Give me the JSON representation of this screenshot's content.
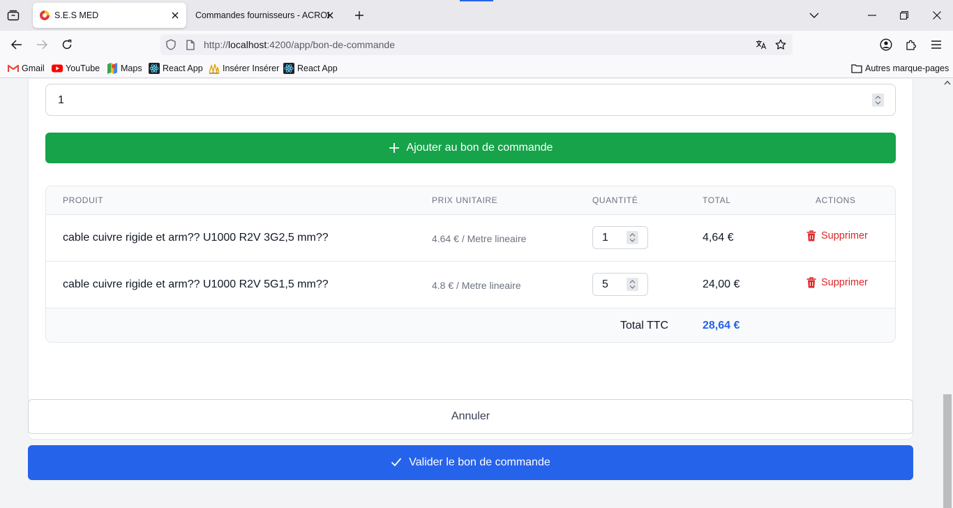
{
  "browser": {
    "tabs": [
      {
        "title": "S.E.S MED",
        "active": true
      },
      {
        "title": "Commandes fournisseurs - ACROBAT",
        "active": false
      }
    ],
    "url": {
      "prefix": "http://",
      "host": "localhost",
      "rest": ":4200/app/bon-de-commande"
    },
    "bookmarks": [
      "Gmail",
      "YouTube",
      "Maps",
      "React App",
      "Insérer Insérer",
      "React App"
    ],
    "other_bookmarks": "Autres marque-pages"
  },
  "form": {
    "quantity_value": "1",
    "add_button_label": "Ajouter au bon de commande"
  },
  "table": {
    "headers": {
      "product": "PRODUIT",
      "unit_price": "PRIX UNITAIRE",
      "quantity": "QUANTITÉ",
      "total": "TOTAL",
      "actions": "ACTIONS"
    },
    "rows": [
      {
        "product": "cable cuivre rigide et arm?? U1000 R2V 3G2,5 mm??",
        "unit_price": "4.64 € / Metre lineaire",
        "quantity": "1",
        "total": "4,64 €",
        "action": "Supprimer"
      },
      {
        "product": "cable cuivre rigide et arm?? U1000 R2V 5G1,5 mm??",
        "unit_price": "4.8 € / Metre lineaire",
        "quantity": "5",
        "total": "24,00 €",
        "action": "Supprimer"
      }
    ],
    "footer": {
      "label": "Total TTC",
      "amount": "28,64 €"
    }
  },
  "actions": {
    "cancel_label": "Annuler",
    "validate_label": "Valider le bon de commande"
  },
  "colors": {
    "add_button": "#16a34a",
    "validate_button": "#2563eb",
    "delete_action": "#dc2626",
    "total_amount": "#2563eb"
  }
}
